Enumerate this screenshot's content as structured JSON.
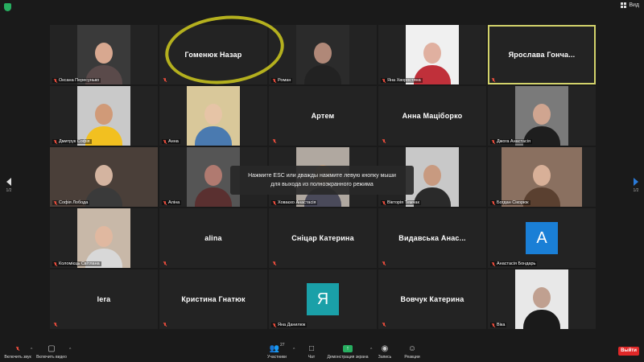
{
  "topbar": {
    "view_label": "Вид"
  },
  "tiles": [
    {
      "name": "Оксана Пересунько",
      "kind": "video",
      "bg": "#3a3a3a",
      "face": "#d8a890",
      "body": "#5a4a4a"
    },
    {
      "name": "Гоменюк Назар",
      "kind": "name"
    },
    {
      "name": "Роман",
      "kind": "video",
      "bg": "#2b2b2b",
      "face": "#b08878",
      "body": "#222222"
    },
    {
      "name": "Яна Хворостяна",
      "kind": "video",
      "bg": "#f0f0f0",
      "face": "#e0b0a0",
      "body": "#c0303a"
    },
    {
      "name": "Ярослава  Гонча...",
      "kind": "name",
      "speaking": true
    },
    {
      "name": "Дмитрук Софія",
      "kind": "video",
      "bg": "#c9c9c9",
      "face": "#d09a78",
      "body": "#f2c020"
    },
    {
      "name": "Анна",
      "kind": "video",
      "bg": "#d9c89a",
      "face": "#e6c4a6",
      "body": "#4a7ab0"
    },
    {
      "name": "Артем",
      "kind": "name"
    },
    {
      "name": "Анна Маціборко",
      "kind": "name"
    },
    {
      "name": "Джога Анастасія",
      "kind": "video",
      "bg": "#7a7a7a",
      "face": "#d0a590",
      "body": "#1e1e1e"
    },
    {
      "name": "Софія Лобода",
      "kind": "video-full",
      "bg": "#4a3f39",
      "face": "#d4b4a0",
      "body": "#3a3a3a"
    },
    {
      "name": "Аліна",
      "kind": "video",
      "bg": "#555555",
      "face": "#b07a70",
      "body": "#5a3030"
    },
    {
      "name": "Ховаєко Анастасія",
      "kind": "video",
      "bg": "#b0a8a0",
      "face": "#d0b090",
      "body": "#4a4a5a"
    },
    {
      "name": "Вікторія Темчак",
      "kind": "video",
      "bg": "#c8c8c8",
      "face": "#c89a80",
      "body": "#2a2a2a"
    },
    {
      "name": "Богдан Сікорюк",
      "kind": "video-wide",
      "bg": "#8a7060",
      "face": "#d8b098",
      "body": "#5a4030"
    },
    {
      "name": "Коломієць Світлана",
      "kind": "video",
      "bg": "#c8b8a8",
      "face": "#e0b8a0",
      "body": "#d8d8d8"
    },
    {
      "name": "alina",
      "kind": "name"
    },
    {
      "name": "Сніцар Катерина",
      "kind": "name"
    },
    {
      "name": "Видавська  Анас...",
      "kind": "name"
    },
    {
      "name": "Анастасія Бондарь",
      "kind": "avatar",
      "letter": "A",
      "color": "#1a7fd6"
    },
    {
      "name": "lera",
      "kind": "name"
    },
    {
      "name": "Кристина Гнатюк",
      "kind": "name"
    },
    {
      "name": "Яна Данилюк",
      "kind": "avatar",
      "letter": "Я",
      "color": "#1aa0a8"
    },
    {
      "name": "Вовчук Катерина",
      "kind": "name"
    },
    {
      "name": "Віка",
      "kind": "video",
      "bg": "#e8e8e8",
      "face": "#c0a090",
      "body": "#1a1a1a"
    }
  ],
  "toast": {
    "line1": "Нажмите ESC или дважды нажмите левую кнопку мыши",
    "line2": "для выхода из полноэкранного режима"
  },
  "pager": {
    "left": "1/2",
    "right": "1/2"
  },
  "toolbar": {
    "unmute": "Включить звук",
    "start_video": "Включить видео",
    "participants": "Участники",
    "participants_count": "27",
    "chat": "Чат",
    "share": "Демонстрация экрана",
    "record": "Запись",
    "reactions": "Реакции",
    "leave": "Выйти"
  }
}
